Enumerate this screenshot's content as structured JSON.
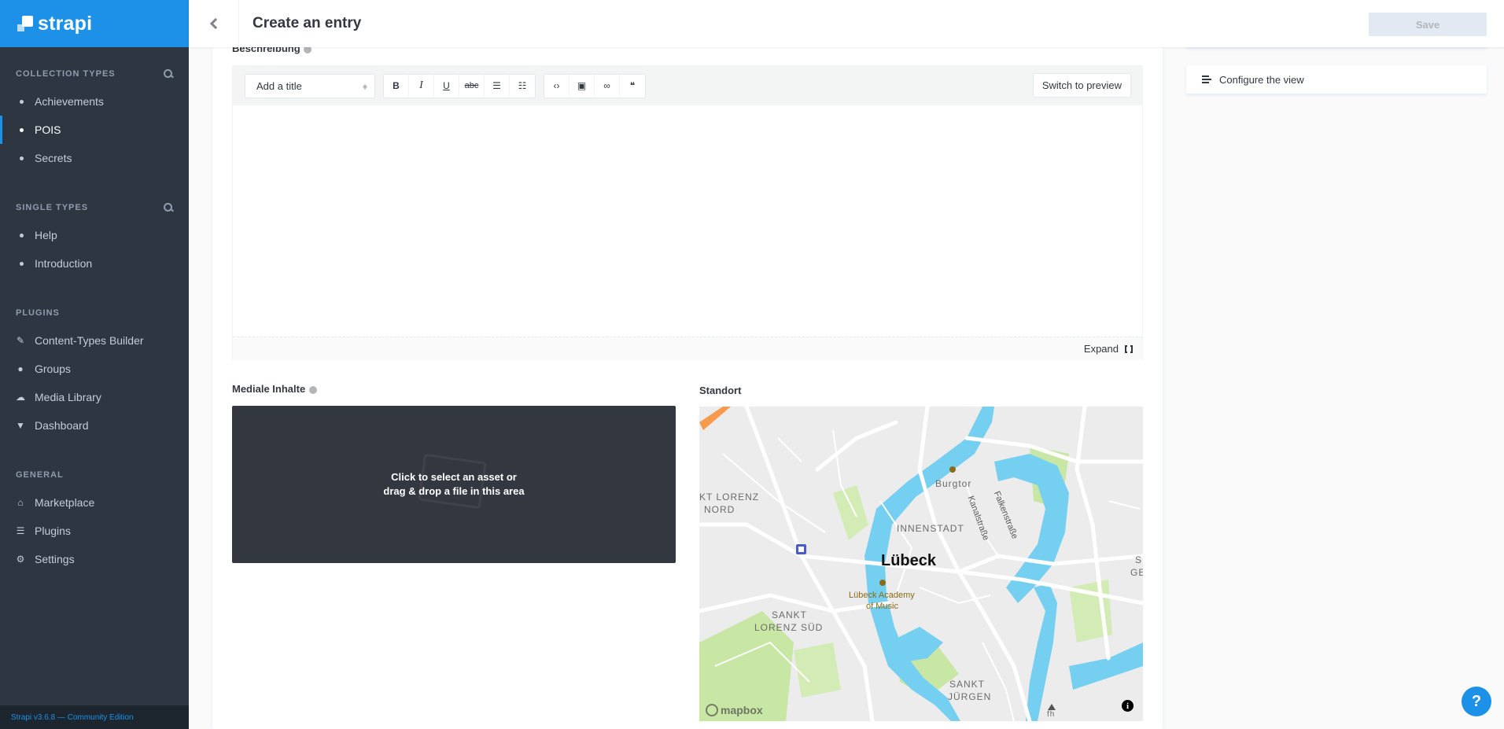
{
  "brand": {
    "name": "strapi"
  },
  "sidebar": {
    "collection_types": {
      "title": "Collection Types",
      "items": [
        {
          "label": "Achievements"
        },
        {
          "label": "POIS"
        },
        {
          "label": "Secrets"
        }
      ]
    },
    "single_types": {
      "title": "Single Types",
      "items": [
        {
          "label": "Help"
        },
        {
          "label": "Introduction"
        }
      ]
    },
    "plugins": {
      "title": "Plugins",
      "items": [
        {
          "label": "Content-Types Builder",
          "icon": "brush-icon"
        },
        {
          "label": "Groups",
          "icon": "users-icon"
        },
        {
          "label": "Media Library",
          "icon": "cloud-upload-icon"
        },
        {
          "label": "Dashboard",
          "icon": "pin-icon"
        }
      ]
    },
    "general": {
      "title": "General",
      "items": [
        {
          "label": "Marketplace",
          "icon": "shop-icon"
        },
        {
          "label": "Plugins",
          "icon": "list-icon"
        },
        {
          "label": "Settings",
          "icon": "gear-icon"
        }
      ]
    },
    "footer": "Strapi v3.6.8 — Community Edition"
  },
  "header": {
    "title": "Create an entry",
    "save_label": "Save"
  },
  "fields": {
    "description": {
      "label": "Beschreibung",
      "title_select": "Add a title",
      "toolbar": [
        "B",
        "I",
        "U",
        "abc"
      ],
      "preview_label": "Switch to preview",
      "expand_label": "Expand"
    },
    "media": {
      "label": "Mediale Inhalte",
      "line1": "Click to select an asset or",
      "line2": "drag & drop a file in this area"
    },
    "location": {
      "label": "Standort",
      "map_labels": {
        "city": "Lübeck",
        "burgtor": "Burgtor",
        "innenstadt": "INNENSTADT",
        "lorenz_nord_1": "KT LORENZ",
        "lorenz_nord_2": "NORD",
        "lorenz_sued_1": "SANKT",
        "lorenz_sued_2": "LORENZ SÜD",
        "juergen_1": "SANKT",
        "juergen_2": "JÜRGEN",
        "academy_1": "Lübeck Academy",
        "academy_2": "of Music",
        "kanal": "Kanalstraße",
        "falken": "Falkenstraße",
        "edge_s": "S",
        "edge_ge": "GE",
        "fh": "fh",
        "attribution": "mapbox"
      }
    }
  },
  "side_panel": {
    "configure_label": "Configure the view"
  },
  "colors": {
    "brand": "#1c91e7",
    "sidebar": "#2e3642",
    "water": "#75cff0",
    "park": "#c8e6a4"
  }
}
